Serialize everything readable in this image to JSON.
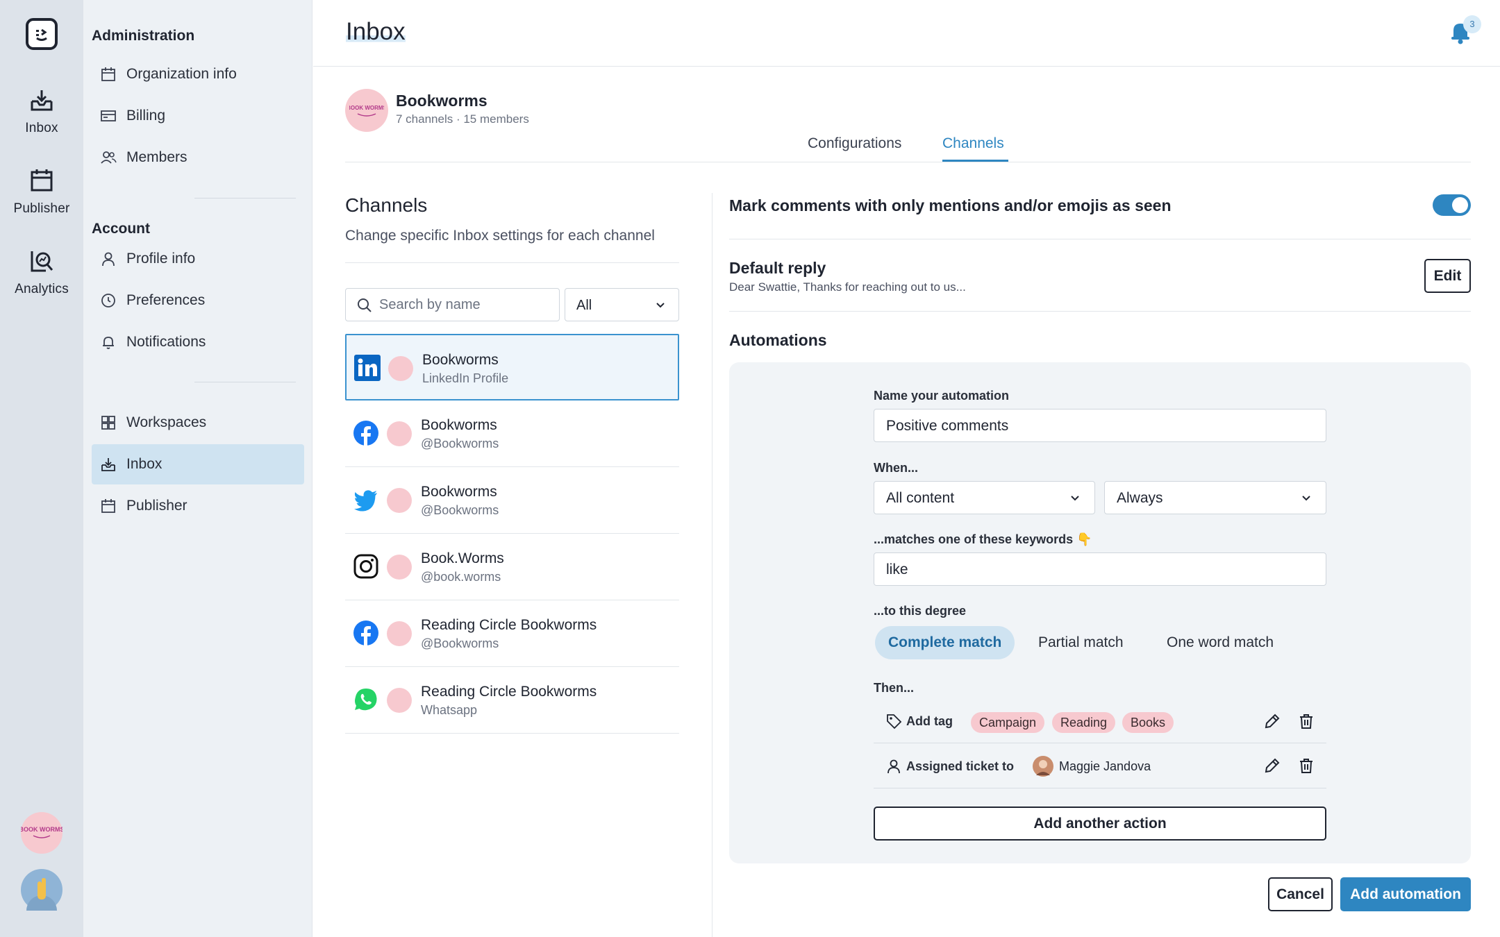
{
  "rail": {
    "items": [
      {
        "label": "Inbox",
        "icon": "inbox-icon"
      },
      {
        "label": "Publisher",
        "icon": "calendar-icon"
      },
      {
        "label": "Analytics",
        "icon": "analytics-icon"
      }
    ],
    "logo_text": "BOOK WORMS"
  },
  "sidebar": {
    "administration_heading": "Administration",
    "admin_items": [
      {
        "label": "Organization info",
        "icon": "calendar-icon"
      },
      {
        "label": "Billing",
        "icon": "billing-icon"
      },
      {
        "label": "Members",
        "icon": "members-icon"
      }
    ],
    "account_heading": "Account",
    "account_items": [
      {
        "label": "Profile info",
        "icon": "user-icon"
      },
      {
        "label": "Preferences",
        "icon": "clock-icon"
      },
      {
        "label": "Notifications",
        "icon": "bell-icon"
      }
    ],
    "workspace_items": [
      {
        "label": "Workspaces",
        "icon": "workspaces-icon"
      },
      {
        "label": "Inbox",
        "icon": "inbox-icon",
        "active": true
      },
      {
        "label": "Publisher",
        "icon": "calendar-icon"
      }
    ]
  },
  "header": {
    "title": "Inbox",
    "notification_count": "3"
  },
  "workspace": {
    "name": "Bookworms",
    "subtitle": "7 channels · 15 members",
    "avatar_text": "BOOK WORMS",
    "tabs": [
      {
        "label": "Configurations",
        "active": false
      },
      {
        "label": "Channels",
        "active": true
      }
    ]
  },
  "channels": {
    "title": "Channels",
    "description": "Change specific Inbox settings for each channel",
    "search_placeholder": "Search by name",
    "filter_value": "All",
    "list": [
      {
        "name": "Bookworms",
        "handle": "LinkedIn Profile",
        "network": "linkedin-icon",
        "selected": true
      },
      {
        "name": "Bookworms",
        "handle": "@Bookworms",
        "network": "facebook-icon"
      },
      {
        "name": "Bookworms",
        "handle": "@Bookworms",
        "network": "twitter-icon"
      },
      {
        "name": "Book.Worms",
        "handle": "@book.worms",
        "network": "instagram-icon"
      },
      {
        "name": "Reading Circle Bookworms",
        "handle": "@Bookworms",
        "network": "facebook-icon"
      },
      {
        "name": "Reading Circle Bookworms",
        "handle": "Whatsapp",
        "network": "whatsapp-icon"
      }
    ]
  },
  "settings": {
    "mark_seen_label": "Mark comments with only mentions and/or emojis as seen",
    "mark_seen_on": true,
    "default_reply_title": "Default reply",
    "default_reply_text": "Dear Swattie, Thanks for reaching out to us...",
    "edit_label": "Edit",
    "automations_title": "Automations"
  },
  "automation": {
    "name_label": "Name your automation",
    "name_value": "Positive comments",
    "when_label": "When...",
    "content_value": "All content",
    "frequency_value": "Always",
    "keywords_label": "...matches one of these keywords",
    "keywords_emoji": "👇",
    "keywords_value": "like",
    "degree_label": "...to this degree",
    "degree_options": [
      "Complete match",
      "Partial match",
      "One word match"
    ],
    "degree_selected": "Complete match",
    "then_label": "Then...",
    "actions": [
      {
        "label": "Add tag",
        "tags": [
          "Campaign",
          "Reading",
          "Books"
        ]
      },
      {
        "label": "Assigned ticket to",
        "assignee": "Maggie Jandova"
      }
    ],
    "add_action_label": "Add another action"
  },
  "footer": {
    "cancel_label": "Cancel",
    "submit_label": "Add automation"
  },
  "colors": {
    "accent": "#2e86c1",
    "tag_bg": "#f7c9cf",
    "selected_bg": "#cfe3f1"
  }
}
